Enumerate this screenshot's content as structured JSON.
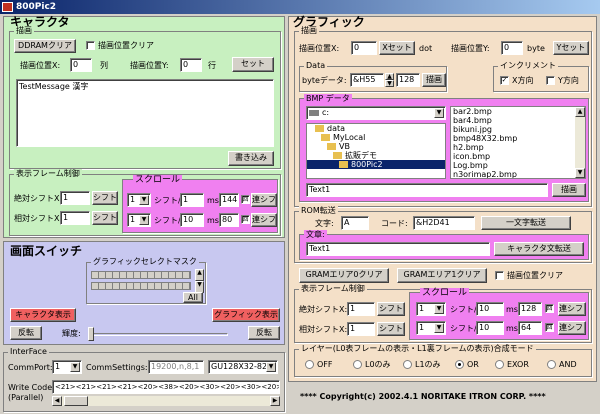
{
  "window": {
    "title": "800Pic2"
  },
  "character": {
    "title": "キャラクタ",
    "draw_group": "描画",
    "ddram_clear": "DDRAMクリア",
    "draw_pos_clear": "描画位置クリア",
    "pos_x_label": "描画位置X:",
    "pos_x_value": "0",
    "col_unit": "列",
    "pos_y_label": "描画位置Y:",
    "pos_y_value": "0",
    "row_unit": "行",
    "set_button": "セット",
    "message_text": "TestMessage 漢字",
    "write_button": "書き込み"
  },
  "char_frame": {
    "group": "表示フレーム制御",
    "abs_shift_x_label": "絶対シフトX:",
    "abs_shift_x_value": "1",
    "shift_button": "シフト",
    "rel_shift_x_label": "相対シフトX:",
    "rel_shift_x_value": "1",
    "rel_shift_button": "シフト",
    "scroll_group": "スクロール",
    "scroll1_value": "1",
    "shift_label": "シフト/",
    "scroll1_ms": "1",
    "ms_label": "ms",
    "scroll1_count": "144",
    "scroll1_check": "回",
    "continuous_shift": "連シフト",
    "scroll2_value": "1",
    "scroll2_ms": "10",
    "scroll2_count": "80",
    "scroll2_check": "回",
    "continuous_shift2": "連シフト"
  },
  "screen_switch": {
    "title": "画面スイッチ",
    "mask_group": "グラフィックセレクトマスク",
    "all_button": "All",
    "char_display": "キャラクタ表示",
    "graphic_display": "グラフィック表示",
    "invert_left": "反転",
    "invert_right": "反転",
    "brightness_label": "輝度:"
  },
  "interface": {
    "group": "InterFace",
    "comm_port_label": "CommPort:",
    "comm_port_value": "1",
    "comm_settings_label": "CommSettings:",
    "comm_settings_value": "19200,n,8,1",
    "module_value": "GU128X32-820",
    "write_code_label": "Write Code",
    "write_code_sub": "(Parallel)",
    "write_code_value": "<21><21><21><21><20><38><20><30><20><30><20><50><20>"
  },
  "graphic": {
    "title": "グラフィック",
    "draw_group": "描画",
    "pos_x_label": "描画位置X:",
    "pos_x_value": "0",
    "x_set_button": "Xセット",
    "dot_unit": "dot",
    "pos_y_label": "描画位置Y:",
    "pos_y_value": "0",
    "byte_unit": "byte",
    "y_set_button": "Yセット",
    "data_group": "Data",
    "byte_data_label": "byteデータ:",
    "byte_data_value": "&H55",
    "byte_count_value": "128",
    "draw_button": "描画",
    "increment_group": "インクリメント",
    "x_direction": "X方向",
    "y_direction": "Y方向",
    "bmp_group": "BMP データ",
    "drive_value": "c:",
    "folders": [
      "data",
      "MyLocal",
      "VB",
      "拡販デモ",
      "800Pic2"
    ],
    "files": [
      "bar2.bmp",
      "bar4.bmp",
      "bikuni.jpg",
      "bmp48X32.bmp",
      "h2.bmp",
      "icon.bmp",
      "Log.bmp",
      "n3orimap2.bmp"
    ],
    "bmp_text": "Text1",
    "bmp_draw_button": "描画"
  },
  "rom": {
    "group": "ROM転送",
    "char_label": "文字:",
    "char_value": "A",
    "code_label": "コード:",
    "code_value": "&H2D41",
    "one_char_button": "一文字転送",
    "sentence_group": "文章:",
    "sentence_value": "Text1",
    "sentence_button": "キャラクタ文転送"
  },
  "gram": {
    "area0_clear": "GRAMエリア0クリア",
    "area1_clear": "GRAMエリア1クリア",
    "draw_pos_clear": "描画位置クリア"
  },
  "gfx_frame": {
    "group": "表示フレーム制御",
    "abs_shift_x_label": "絶対シフトX:",
    "abs_shift_x_value": "1",
    "shift_button": "シフト",
    "rel_shift_x_label": "相対シフトX:",
    "rel_shift_x_value": "1",
    "rel_shift_button": "シフト",
    "scroll_group": "スクロール",
    "scroll1_value": "1",
    "shift_label": "シフト/",
    "scroll1_ms": "10",
    "ms_label": "ms",
    "scroll1_count": "128",
    "scroll1_check": "回",
    "continuous_shift": "連シフト",
    "scroll2_value": "1",
    "scroll2_ms": "10",
    "scroll2_count": "64",
    "scroll2_check": "回",
    "continuous_shift2": "連シフト"
  },
  "layer": {
    "group": "レイヤー(L0表フレームの表示・L1裏フレームの表示)合成モード",
    "options": [
      "OFF",
      "L0のみ",
      "L1のみ",
      "OR",
      "EXOR",
      "AND"
    ],
    "selected": "OR"
  },
  "copyright": "**** Copyright(c) 2002.4.1 NORITAKE ITRON CORP. ****",
  "colors": {
    "character_bg": "#c8f0c0",
    "screen_bg": "#c8c8f0",
    "graphic_bg": "#f4e0c8",
    "pink": "#f080f0",
    "selection": "#0a246a"
  }
}
